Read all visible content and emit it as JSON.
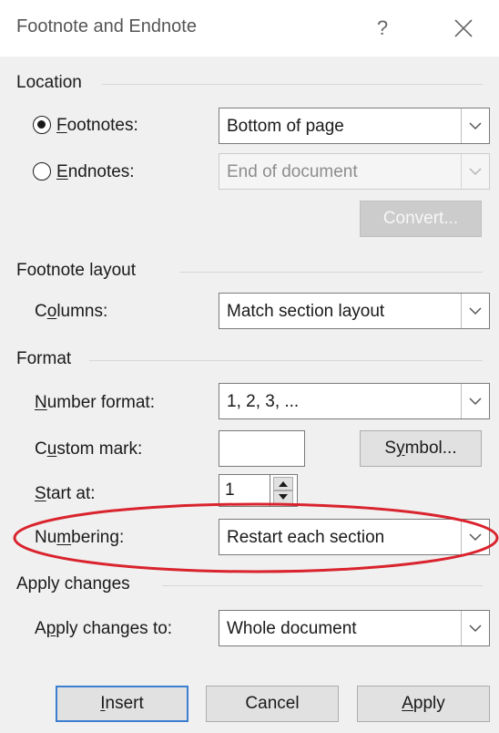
{
  "window": {
    "title": "Footnote and Endnote",
    "help_label": "?",
    "close_icon": "close-icon"
  },
  "location": {
    "label": "Location",
    "footnotes": {
      "mnemonic": "F",
      "rest": "ootnotes:",
      "selected": true,
      "value": "Bottom of page"
    },
    "endnotes": {
      "mnemonic": "E",
      "rest": "ndnotes:",
      "selected": false,
      "value": "End of document",
      "disabled": true
    },
    "convert_label": "Convert..."
  },
  "footnote_layout": {
    "label": "Footnote layout",
    "columns": {
      "pre": "C",
      "mnemonic": "o",
      "rest": "lumns:",
      "value": "Match section layout"
    }
  },
  "format": {
    "label": "Format",
    "number_format": {
      "mnemonic": "N",
      "rest": "umber format:",
      "value": "1, 2, 3, ..."
    },
    "custom_mark": {
      "pre": "C",
      "mnemonic": "u",
      "rest": "stom mark:",
      "value": ""
    },
    "symbol": {
      "pre": "S",
      "mnemonic": "y",
      "rest": "mbol..."
    },
    "start_at": {
      "mnemonic": "S",
      "rest": "tart at:",
      "value": "1"
    },
    "numbering": {
      "pre": "Nu",
      "mnemonic": "m",
      "rest": "bering:",
      "value": "Restart each section"
    }
  },
  "apply_changes": {
    "label": "Apply changes",
    "apply_to": {
      "pre": "A",
      "mnemonic": "p",
      "rest": "ply changes to:",
      "value": "Whole document"
    }
  },
  "buttons": {
    "insert": {
      "mnemonic": "I",
      "rest": "nsert"
    },
    "cancel": "Cancel",
    "apply": {
      "mnemonic": "A",
      "rest": "pply"
    }
  },
  "annotation": {
    "color": "#d9232d"
  }
}
